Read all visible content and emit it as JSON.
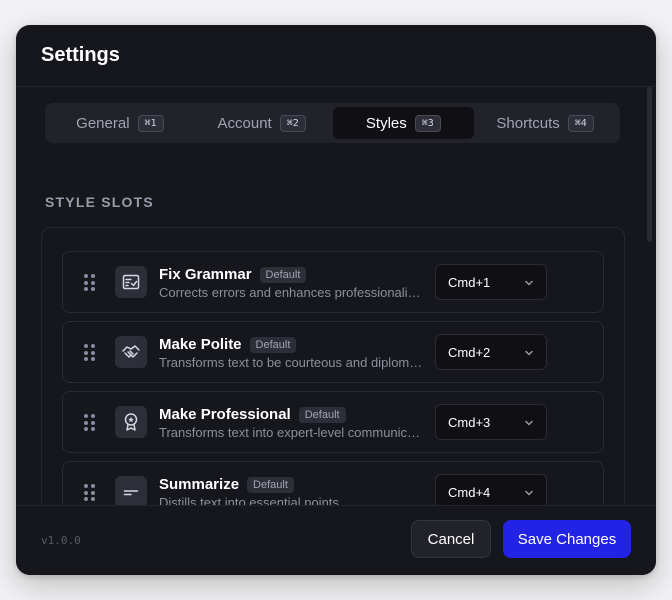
{
  "dialog": {
    "title": "Settings"
  },
  "tabs": [
    {
      "label": "General",
      "shortcut": "⌘1"
    },
    {
      "label": "Account",
      "shortcut": "⌘2"
    },
    {
      "label": "Styles",
      "shortcut": "⌘3",
      "active": true
    },
    {
      "label": "Shortcuts",
      "shortcut": "⌘4"
    }
  ],
  "section": {
    "label": "STYLE SLOTS"
  },
  "slots": [
    {
      "name": "Fix Grammar",
      "badge": "Default",
      "description": "Corrects errors and enhances professionalism",
      "shortcut": "Cmd+1",
      "icon": "checklist-icon"
    },
    {
      "name": "Make Polite",
      "badge": "Default",
      "description": "Transforms text to be courteous and diplomatic",
      "shortcut": "Cmd+2",
      "icon": "handshake-icon"
    },
    {
      "name": "Make Professional",
      "badge": "Default",
      "description": "Transforms text into expert-level communication",
      "shortcut": "Cmd+3",
      "icon": "award-icon"
    },
    {
      "name": "Summarize",
      "badge": "Default",
      "description": "Distills text into essential points",
      "shortcut": "Cmd+4",
      "icon": "text-lines-icon"
    }
  ],
  "footer": {
    "version": "v1.0.0",
    "cancel_label": "Cancel",
    "save_label": "Save Changes"
  },
  "colors": {
    "accent": "#2323e6",
    "background": "#16161d"
  }
}
